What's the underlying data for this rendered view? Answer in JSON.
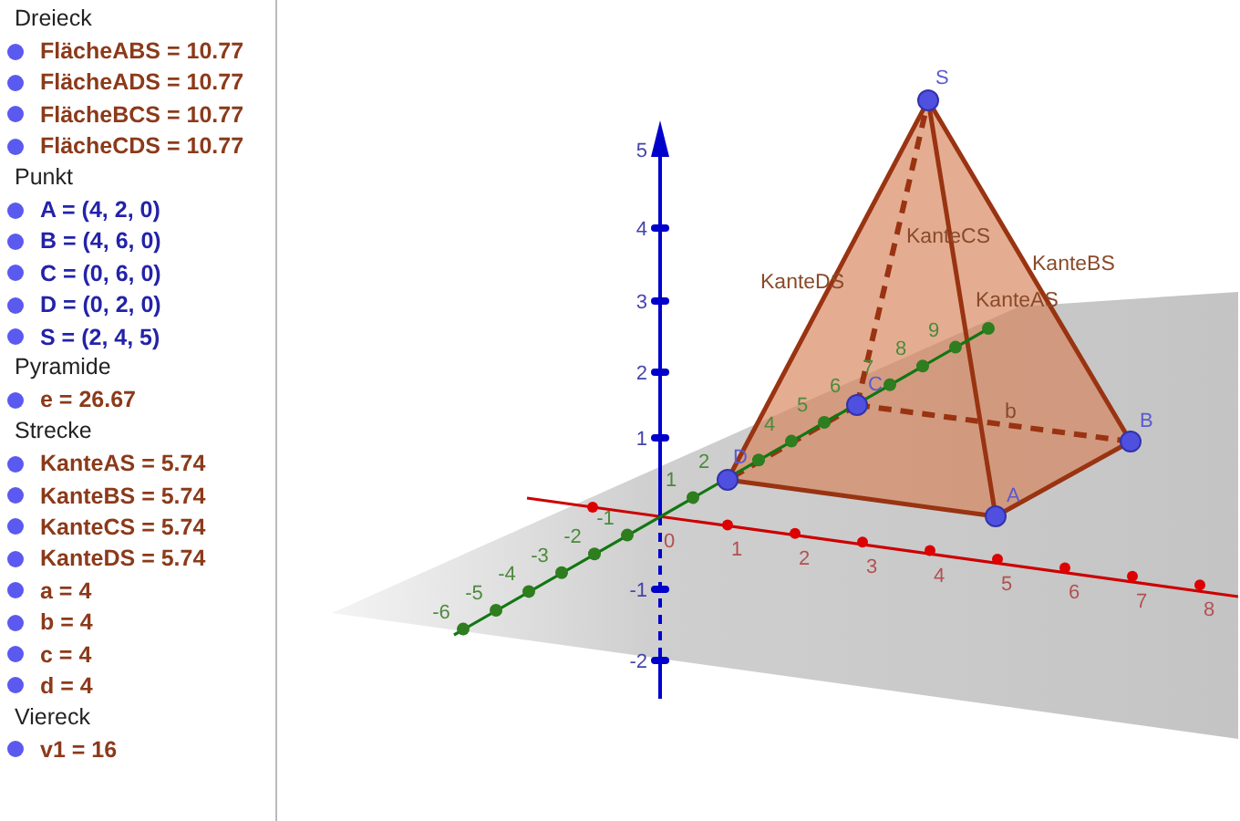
{
  "algebra": {
    "groups": [
      {
        "title": "Dreieck",
        "items": [
          {
            "text": "FlächeABS = 10.77",
            "kind": "value"
          },
          {
            "text": "FlächeADS = 10.77",
            "kind": "value"
          },
          {
            "text": "FlächeBCS = 10.77",
            "kind": "value"
          },
          {
            "text": "FlächeCDS = 10.77",
            "kind": "value"
          }
        ]
      },
      {
        "title": "Punkt",
        "items": [
          {
            "text": "A = (4, 2, 0)",
            "kind": "point"
          },
          {
            "text": "B = (4, 6, 0)",
            "kind": "point"
          },
          {
            "text": "C = (0, 6, 0)",
            "kind": "point"
          },
          {
            "text": "D = (0, 2, 0)",
            "kind": "point"
          },
          {
            "text": "S = (2, 4, 5)",
            "kind": "point"
          }
        ]
      },
      {
        "title": "Pyramide",
        "items": [
          {
            "text": "e = 26.67",
            "kind": "value"
          }
        ]
      },
      {
        "title": "Strecke",
        "items": [
          {
            "text": "KanteAS = 5.74",
            "kind": "value"
          },
          {
            "text": "KanteBS = 5.74",
            "kind": "value"
          },
          {
            "text": "KanteCS = 5.74",
            "kind": "value"
          },
          {
            "text": "KanteDS = 5.74",
            "kind": "value"
          },
          {
            "text": "a = 4",
            "kind": "value"
          },
          {
            "text": "b = 4",
            "kind": "value"
          },
          {
            "text": "c = 4",
            "kind": "value"
          },
          {
            "text": "d = 4",
            "kind": "value"
          }
        ]
      },
      {
        "title": "Viereck",
        "items": [
          {
            "text": "v1 = 16",
            "kind": "value"
          }
        ]
      }
    ]
  },
  "view3d": {
    "point_labels": [
      "S",
      "A",
      "B",
      "C",
      "D"
    ],
    "edge_labels": [
      "KanteCS",
      "KanteDS",
      "KanteBS",
      "KanteAS",
      "b"
    ],
    "z_ticks": [
      "5",
      "4",
      "3",
      "2",
      "1",
      "-1",
      "-2"
    ],
    "x_ticks": [
      "0",
      "1",
      "2",
      "3",
      "4",
      "5",
      "6",
      "7",
      "8"
    ],
    "y_ticks": [
      "-6",
      "-5",
      "-4",
      "-3",
      "-2",
      "-1",
      "1",
      "2",
      "4",
      "5",
      "6",
      "7",
      "8",
      "9"
    ]
  }
}
